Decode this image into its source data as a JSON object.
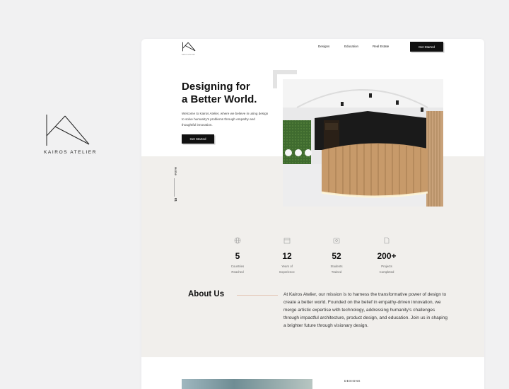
{
  "brand": {
    "name": "KAIROS ATELIER",
    "logo_icon": "ka-monogram-icon"
  },
  "nav": {
    "designs": "Designs",
    "education": "Education",
    "real_estate": "Real Estate",
    "cta": "Get Started"
  },
  "hero": {
    "title_line1": "Designing for",
    "title_line2": "a Better World.",
    "text": "Welcome to Kairos Atelier, where we believe in using design to solve humanity's problems through empathy and thoughtful innovation.",
    "cta": "Get Started",
    "image": "reception-interior-photo"
  },
  "side": {
    "label": "Home",
    "number": "01"
  },
  "stats": [
    {
      "value": "5",
      "label1": "Countries",
      "label2": "Reached",
      "icon": "globe-icon"
    },
    {
      "value": "12",
      "label1": "Years of",
      "label2": "Experience",
      "icon": "calendar-icon"
    },
    {
      "value": "52",
      "label1": "Students",
      "label2": "Trained",
      "icon": "students-icon"
    },
    {
      "value": "200+",
      "label1": "Projects",
      "label2": "Completed",
      "icon": "document-icon"
    }
  ],
  "about": {
    "title": "About Us",
    "text": "At Kairos Atelier, our mission is to harness the transformative power of design to create a better world. Founded on the belief in empathy-driven innovation, we merge artistic expertise with technology, addressing humanity's challenges through impactful architecture, product design, and education. Join us in shaping a brighter future through visionary design."
  },
  "preview": {
    "label": "DESIGNS"
  },
  "colors": {
    "background": "#f1f1f2",
    "band": "#f1efec",
    "accent_line": "#e4c9b8",
    "dark": "#111111"
  }
}
